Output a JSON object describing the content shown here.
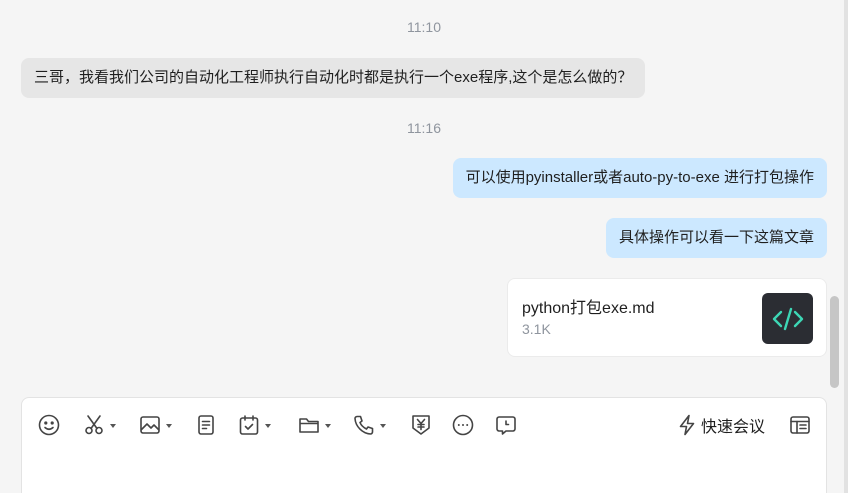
{
  "messages": {
    "time1": "11:10",
    "msg1": "三哥，我看我们公司的自动化工程师执行自动化时都是执行一个exe程序,这个是怎么做的？",
    "time2": "11:16",
    "msg2": "可以使用pyinstaller或者auto-py-to-exe 进行打包操作",
    "msg3": "具体操作可以看一下这篇文章"
  },
  "file": {
    "name": "python打包exe.md",
    "size": "3.1K",
    "icon": "code-icon"
  },
  "toolbar": {
    "items": [
      "emoji-icon",
      "scissors-icon",
      "image-icon",
      "document-icon",
      "calendar-check-icon",
      "folder-icon",
      "phone-icon",
      "yen-icon",
      "more-icon",
      "comment-icon",
      "list-panel-icon"
    ],
    "meeting_label": "快速会议"
  },
  "colors": {
    "background": "#f5f5f5",
    "incoming_bubble": "#e6e6e6",
    "outgoing_bubble": "#cce8ff",
    "code_icon_bg": "#2b2d33",
    "code_icon_fg": "#3dd6b5"
  }
}
